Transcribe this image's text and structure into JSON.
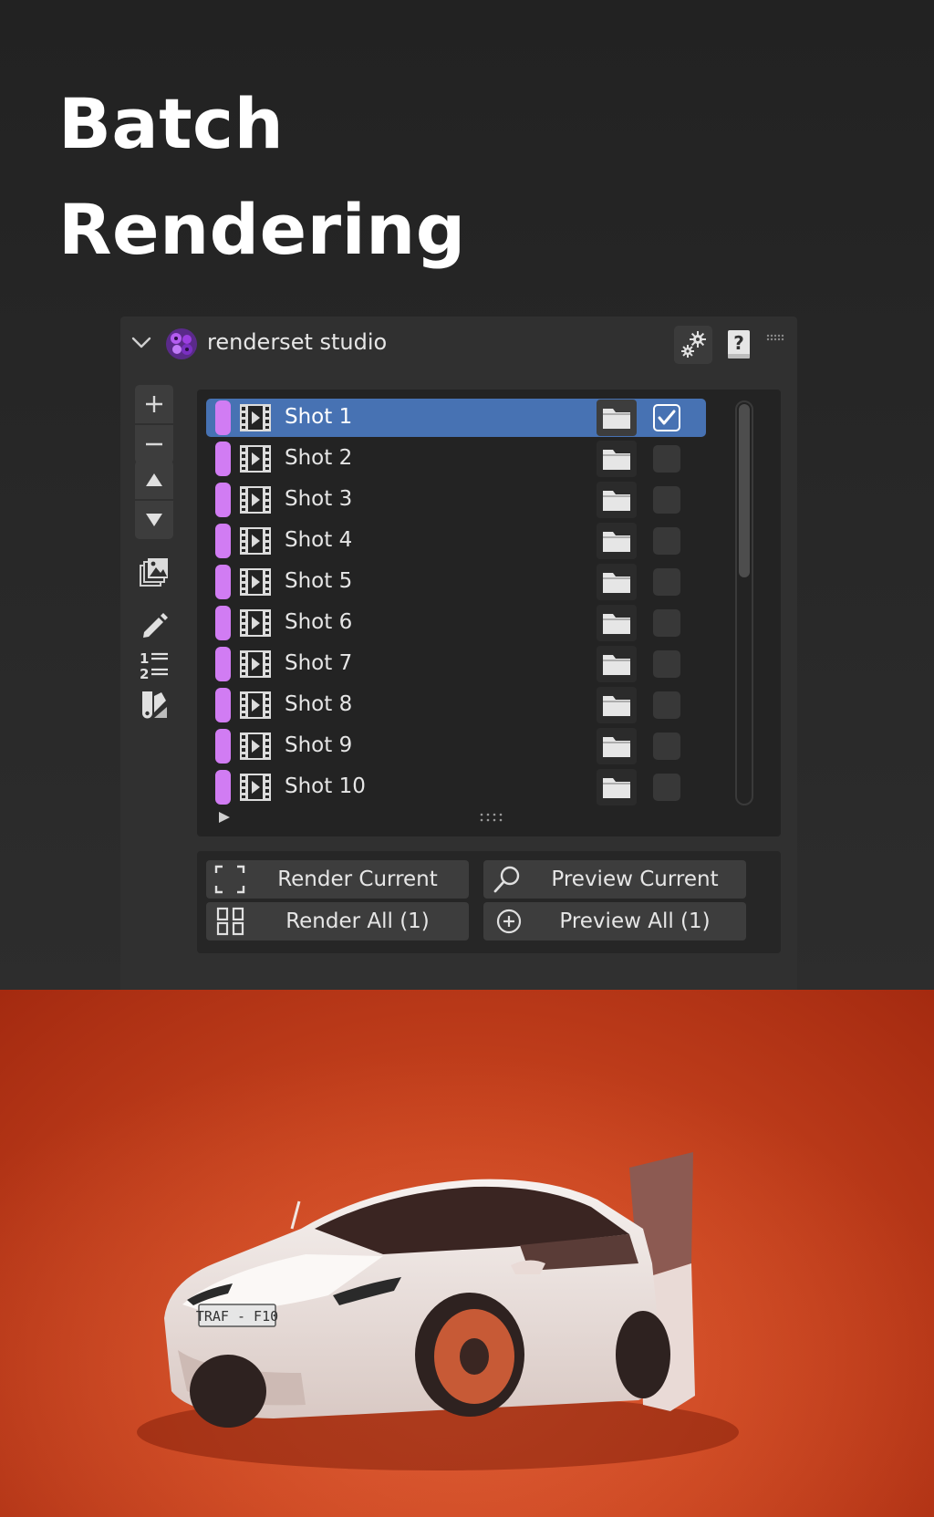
{
  "headline": {
    "line1": "Batch",
    "line2": "Rendering"
  },
  "panel": {
    "title": "renderset studio",
    "header_icons": [
      "chevron-down-icon",
      "renderset-logo",
      "gears-icon",
      "help-book-icon",
      "grip-icon"
    ],
    "tool_icons": [
      "plus-icon",
      "minus-icon",
      "arrow-up-icon",
      "arrow-down-icon",
      "image-stack-icon",
      "pencil-icon",
      "numbered-list-icon",
      "color-swatch-icon"
    ],
    "accent_color": "#4772b3",
    "tag_color": "#d17cf3"
  },
  "shots": [
    {
      "label": "Shot 1",
      "selected": true,
      "checked": true
    },
    {
      "label": "Shot 2",
      "selected": false,
      "checked": false
    },
    {
      "label": "Shot 3",
      "selected": false,
      "checked": false
    },
    {
      "label": "Shot 4",
      "selected": false,
      "checked": false
    },
    {
      "label": "Shot 5",
      "selected": false,
      "checked": false
    },
    {
      "label": "Shot 6",
      "selected": false,
      "checked": false
    },
    {
      "label": "Shot 7",
      "selected": false,
      "checked": false
    },
    {
      "label": "Shot 8",
      "selected": false,
      "checked": false
    },
    {
      "label": "Shot 9",
      "selected": false,
      "checked": false
    },
    {
      "label": "Shot 10",
      "selected": false,
      "checked": false
    }
  ],
  "actions": {
    "render_current": "Render Current",
    "preview_current": "Preview Current",
    "render_all": "Render All (1)",
    "preview_all": "Preview All (1)"
  },
  "photo": {
    "plate_text": "TRAF - F10",
    "background": "#c9441f",
    "car_color": "#eeeeee"
  }
}
